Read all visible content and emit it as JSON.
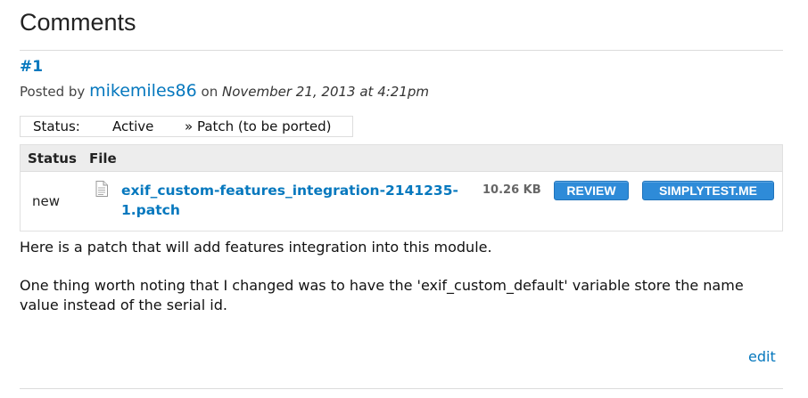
{
  "section": {
    "title": "Comments"
  },
  "comment": {
    "number": "#1",
    "posted_prefix": "Posted by",
    "author": "mikemiles86",
    "on_word": "on",
    "date": "November 21, 2013 at 4:21pm",
    "status_change": {
      "label": "Status:",
      "from": "Active",
      "to": "» Patch (to be ported)"
    },
    "files_table": {
      "headers": [
        "Status",
        "File"
      ],
      "rows": [
        {
          "status": "new",
          "icon": "text-file-icon",
          "filename": "exif_custom-features_integration-2141235-1.patch",
          "size": "10.26 KB",
          "buttons": [
            "REVIEW",
            "SIMPLYTEST.ME"
          ]
        }
      ]
    },
    "body": [
      "Here is a patch that will add features integration into this module.",
      "One thing worth noting that I changed was to have the 'exif_custom_default' variable store the name value instead of the serial id."
    ],
    "edit_label": "edit"
  },
  "colors": {
    "link": "#0678be",
    "button": "#2e8bd8",
    "table_header_bg": "#ededed"
  }
}
